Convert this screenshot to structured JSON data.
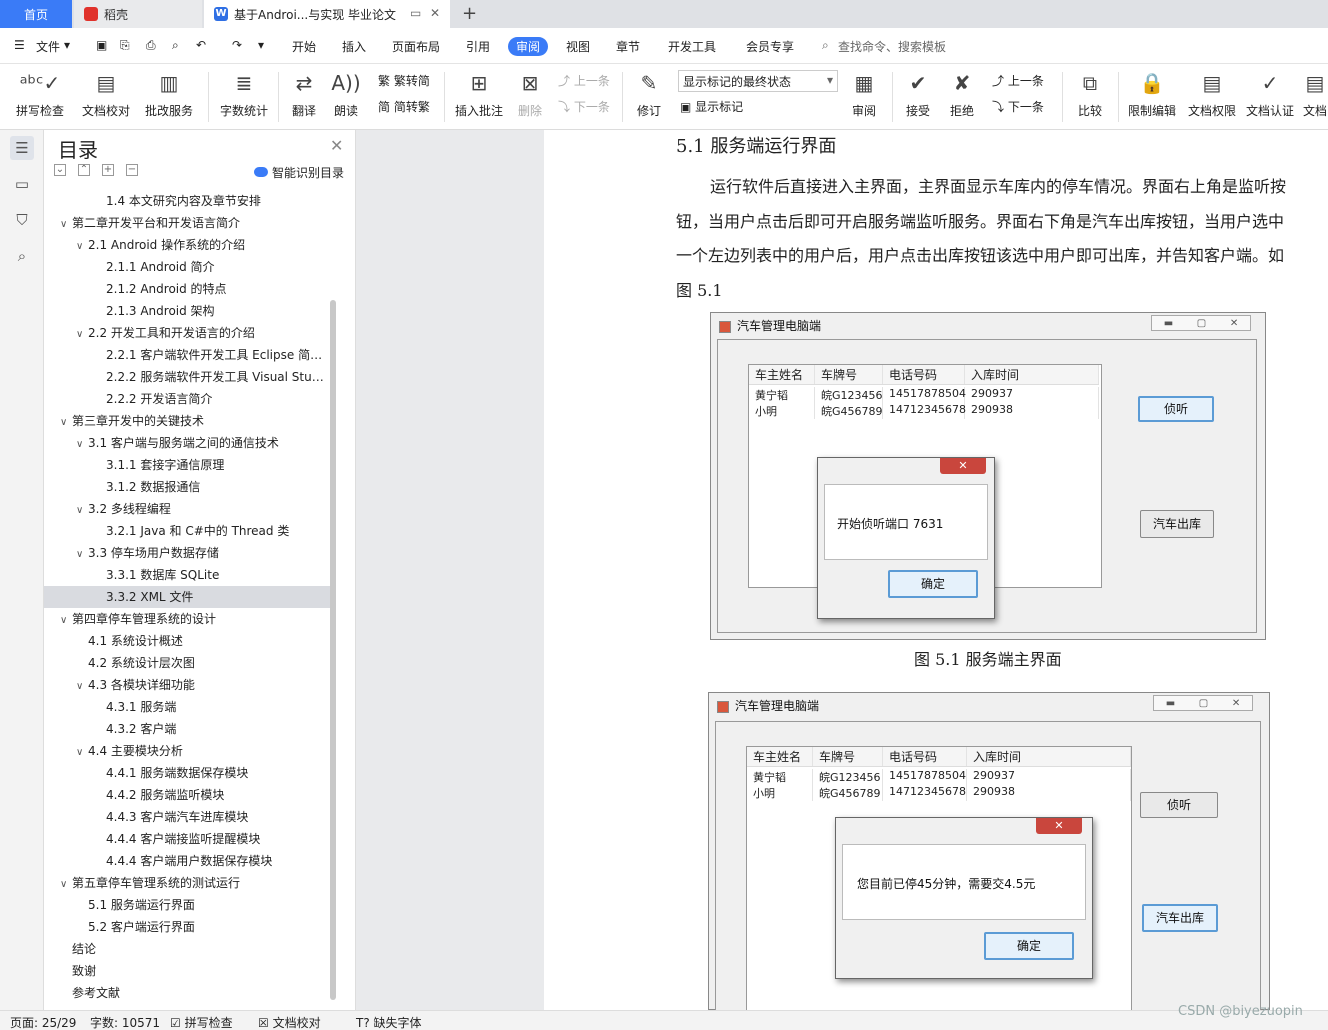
{
  "tabs": {
    "home": "首页",
    "daoke": "稻壳",
    "doc": "基于Androi...与实现 毕业论文",
    "add": "+"
  },
  "menu": {
    "file": "文件",
    "items": [
      "开始",
      "插入",
      "页面布局",
      "引用",
      "审阅",
      "视图",
      "章节",
      "开发工具",
      "会员专享"
    ],
    "active": "审阅",
    "search": "查找命令、搜索模板"
  },
  "ribbon": {
    "spell": "拼写检查",
    "proof": "文档校对",
    "batch": "批改服务",
    "wordcount": "字数统计",
    "translate": "翻译",
    "read": "朗读",
    "trad": "繁转简",
    "simp": "简转繁",
    "insert_comment": "插入批注",
    "delete": "删除",
    "prev": "上一条",
    "next": "下一条",
    "revise": "修订",
    "display_select": "显示标记的最终状态",
    "show_marks": "显示标记",
    "review": "审阅",
    "accept": "接受",
    "reject": "拒绝",
    "prev2": "上一条",
    "next2": "下一条",
    "compare": "比较",
    "restrict": "限制编辑",
    "rights": "文档权限",
    "certify": "文档认证",
    "more": "文档"
  },
  "toc": {
    "title": "目录",
    "smart": "智能识别目录",
    "items": [
      {
        "level": 2,
        "text": "1.4  本文研究内容及章节安排",
        "chev": ""
      },
      {
        "level": 0,
        "text": "第二章开发平台和开发语言简介",
        "chev": "∨"
      },
      {
        "level": 1,
        "text": "2.1 Android 操作系统的介绍",
        "chev": "∨"
      },
      {
        "level": 2,
        "text": "2.1.1 Android 简介",
        "chev": ""
      },
      {
        "level": 2,
        "text": "2.1.2 Android 的特点",
        "chev": ""
      },
      {
        "level": 2,
        "text": "2.1.3 Android 架构",
        "chev": ""
      },
      {
        "level": 1,
        "text": "2.2 开发工具和开发语言的介绍",
        "chev": "∨"
      },
      {
        "level": 2,
        "text": "2.2.1    客户端软件开发工具 Eclipse 简…",
        "chev": ""
      },
      {
        "level": 2,
        "text": "2.2.2  服务端软件开发工具 Visual Stu…",
        "chev": ""
      },
      {
        "level": 2,
        "text": "2.2.2  开发语言简介",
        "chev": ""
      },
      {
        "level": 0,
        "text": "第三章开发中的关键技术",
        "chev": "∨"
      },
      {
        "level": 1,
        "text": "3.1  客户端与服务端之间的通信技术",
        "chev": "∨"
      },
      {
        "level": 2,
        "text": "3.1.1  套接字通信原理",
        "chev": ""
      },
      {
        "level": 2,
        "text": "3.1.2  数据报通信",
        "chev": ""
      },
      {
        "level": 1,
        "text": "3.2 多线程编程",
        "chev": "∨"
      },
      {
        "level": 2,
        "text": "3.2.1    Java 和 C#中的 Thread 类",
        "chev": ""
      },
      {
        "level": 1,
        "text": "3.3  停车场用户数据存储",
        "chev": "∨"
      },
      {
        "level": 2,
        "text": "3.3.1  数据库 SQLite",
        "chev": ""
      },
      {
        "level": 2,
        "text": "3.3.2 XML 文件",
        "chev": "",
        "selected": true
      },
      {
        "level": 0,
        "text": "第四章停车管理系统的设计",
        "chev": "∨"
      },
      {
        "level": 1,
        "text": "4.1  系统设计概述",
        "chev": ""
      },
      {
        "level": 1,
        "text": "4.2    系统设计层次图",
        "chev": ""
      },
      {
        "level": 1,
        "text": "4.3  各模块详细功能",
        "chev": "∨"
      },
      {
        "level": 2,
        "text": "4.3.1  服务端",
        "chev": ""
      },
      {
        "level": 2,
        "text": "4.3.2  客户端",
        "chev": ""
      },
      {
        "level": 1,
        "text": "4.4  主要模块分析",
        "chev": "∨"
      },
      {
        "level": 2,
        "text": "4.4.1  服务端数据保存模块",
        "chev": ""
      },
      {
        "level": 2,
        "text": "4.4.2  服务端监听模块",
        "chev": ""
      },
      {
        "level": 2,
        "text": "4.4.3  客户端汽车进库模块",
        "chev": ""
      },
      {
        "level": 2,
        "text": "4.4.4  客户端接监听提醒模块",
        "chev": ""
      },
      {
        "level": 2,
        "text": "4.4.4  客户端用户数据保存模块",
        "chev": ""
      },
      {
        "level": 0,
        "text": "第五章停车管理系统的测试运行",
        "chev": "∨"
      },
      {
        "level": 1,
        "text": "5.1  服务端运行界面",
        "chev": ""
      },
      {
        "level": 1,
        "text": "5.2  客户端运行界面",
        "chev": ""
      },
      {
        "level": 0,
        "text": "结论",
        "chev": ""
      },
      {
        "level": 0,
        "text": "致谢",
        "chev": ""
      },
      {
        "level": 0,
        "text": "参考文献",
        "chev": ""
      }
    ]
  },
  "doc": {
    "heading": "5.1  服务端运行界面",
    "paragraph": "运行软件后直接进入主界面，主界面显示车库内的停车情况。界面右上角是监听按钮，当用户点击后即可开启服务端监听服务。界面右下角是汽车出库按钮，当用户选中一个左边列表中的用户后，用户点击出库按钮该选中用户即可出库，并告知客户端。如图 5.1",
    "caption": "图 5.1  服务端主界面",
    "window_title": "汽车管理电脑端",
    "grid_headers": [
      "车主姓名",
      "车牌号",
      "电话号码",
      "入库时间"
    ],
    "grid_rows": [
      [
        "黄宁韬",
        "皖G123456",
        "14517878504",
        "290937"
      ],
      [
        "小明",
        "皖G456789",
        "14712345678",
        "290938"
      ]
    ],
    "listen_btn": "侦听",
    "exit_btn": "汽车出库",
    "ok_btn": "确定",
    "dialog1_msg": "开始侦听端口 7631",
    "dialog2_msg": "您目前已停45分钟，需要交4.5元",
    "close_x": "✕"
  },
  "status": {
    "page": "页面: 25/29",
    "words": "字数: 10571",
    "spell": "拼写检查",
    "proof": "文档校对",
    "missing_font": "缺失字体"
  },
  "watermark": "CSDN @biyezuopin",
  "colors": {
    "accent": "#3a7bf7",
    "selected_row": "#d9dbe0",
    "close_red": "#c9463d"
  }
}
